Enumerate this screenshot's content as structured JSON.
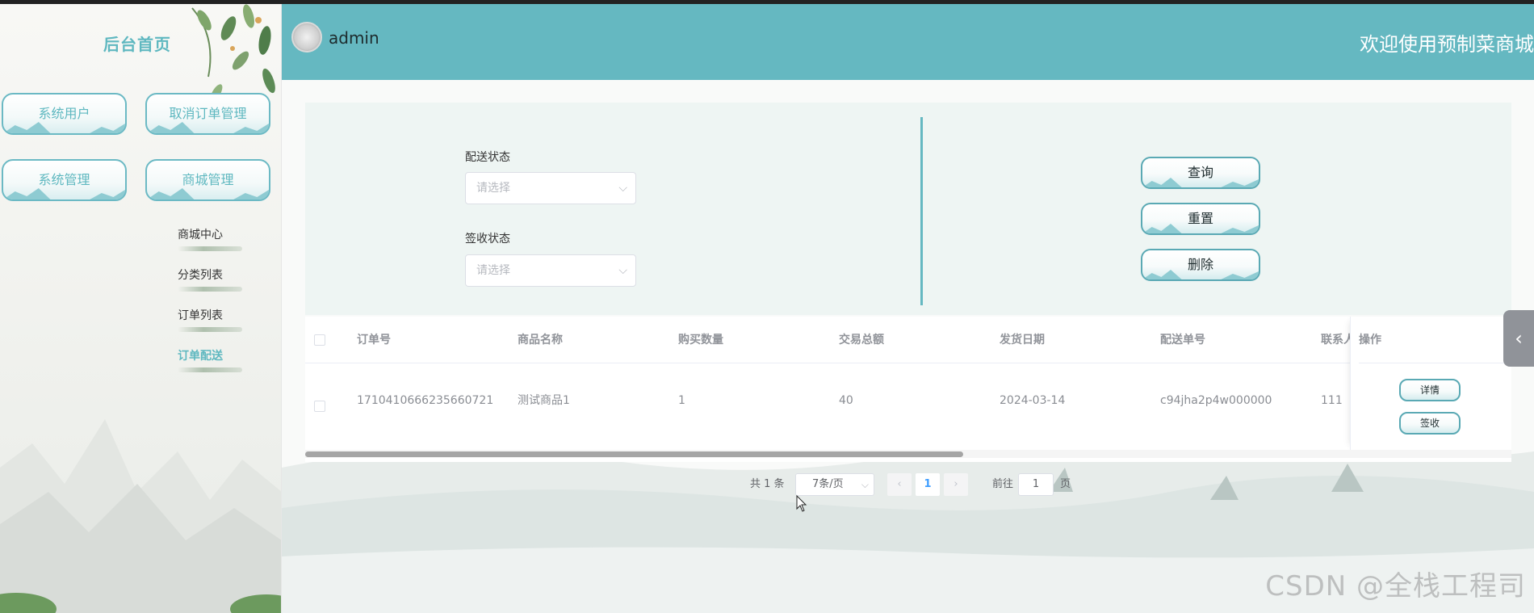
{
  "sidebar": {
    "title": "后台首页",
    "menu": [
      {
        "label": "系统用户"
      },
      {
        "label": "取消订单管理"
      },
      {
        "label": "系统管理"
      },
      {
        "label": "商城管理"
      }
    ],
    "sub_items": [
      {
        "label": "商城中心"
      },
      {
        "label": "分类列表"
      },
      {
        "label": "订单列表"
      },
      {
        "label": "订单配送",
        "active": true
      }
    ]
  },
  "header": {
    "username": "admin",
    "welcome": "欢迎使用预制菜商城"
  },
  "search": {
    "fields": [
      {
        "label": "配送状态",
        "placeholder": "请选择"
      },
      {
        "label": "签收状态",
        "placeholder": "请选择"
      }
    ],
    "buttons": {
      "query": "查询",
      "reset": "重置",
      "delete": "删除"
    }
  },
  "table": {
    "columns": [
      "订单号",
      "商品名称",
      "购买数量",
      "交易总额",
      "发货日期",
      "配送单号",
      "联系人",
      "操作"
    ],
    "rows": [
      {
        "order_no": "1710410666235660721",
        "product": "测试商品1",
        "quantity": "1",
        "total": "40",
        "ship_date": "2024-03-14",
        "delivery_no": "c94jha2p4w000000",
        "contact": "111",
        "actions": [
          "详情",
          "签收"
        ]
      }
    ]
  },
  "pagination": {
    "total": "共 1 条",
    "page_size": "7条/页",
    "current_page": "1",
    "goto_label": "前往",
    "goto_value": "1",
    "page_suffix": "页"
  },
  "watermark": "CSDN @全栈工程司",
  "colors": {
    "header_bg": "#65b8c1",
    "accent": "#5fb8c0",
    "panel_bg": "#eef5f3"
  }
}
